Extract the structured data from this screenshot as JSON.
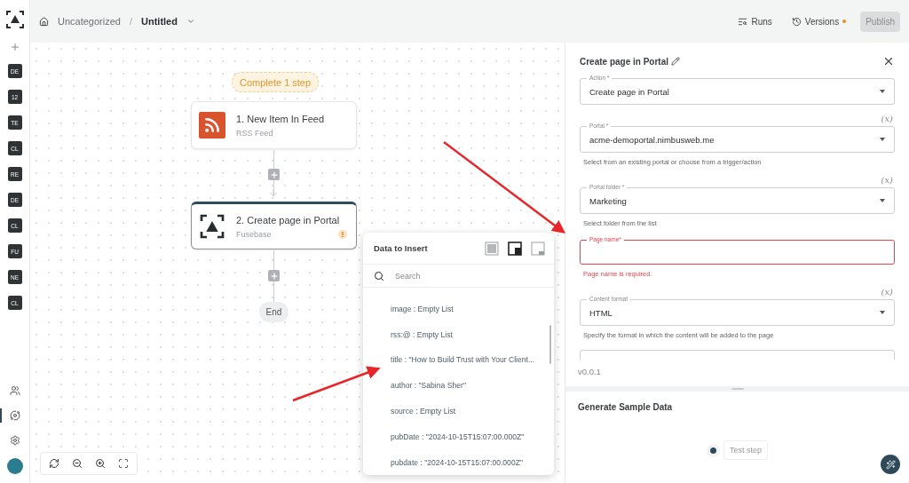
{
  "topbar": {
    "breadcrumb": [
      {
        "label": "Uncategorized",
        "current": false
      },
      {
        "label": "Untitled",
        "current": true
      }
    ],
    "separator": "/",
    "runs": "Runs",
    "versions": {
      "label": "Versions",
      "unsaved": true
    },
    "publish": {
      "label": "Publish",
      "disabled": true
    }
  },
  "sidebar": {
    "badges": [
      "DE",
      "12",
      "TE",
      "CL",
      "RE",
      "DE",
      "CL",
      "FU",
      "NE",
      "CL"
    ],
    "nav": [
      {
        "kind": "people",
        "selected": false
      },
      {
        "kind": "flows",
        "selected": true
      },
      {
        "kind": "settings",
        "selected": false
      }
    ]
  },
  "canvas": {
    "banner": "Complete 1 step",
    "steps": [
      {
        "kind": "rss",
        "title": "1. New Item In Feed",
        "subtitle": "RSS Feed",
        "warning": false,
        "selected": false
      },
      {
        "kind": "app",
        "title": "2. Create page in Portal",
        "subtitle": "Fusebase",
        "warning": true,
        "selected": true
      }
    ],
    "end_label": "End"
  },
  "popover": {
    "title": "Data to Insert",
    "layouts": [
      {
        "kind": "full",
        "selected": false
      },
      {
        "kind": "corner",
        "selected": true
      },
      {
        "kind": "bottom",
        "selected": false
      }
    ],
    "search_placeholder": "Search",
    "items": [
      "image : Empty List",
      "rss:@ : Empty List",
      "title : \"How to Build Trust with Your Client...",
      "author : \"Sabina Sher\"",
      "source : Empty List",
      "pubDate : \"2024-10-15T15:07:00.000Z\"",
      "pubdate : \"2024-10-15T15:07:00.000Z\""
    ]
  },
  "panel": {
    "title": "Create page in Portal",
    "fields": [
      {
        "kind": "select",
        "label": "Action *",
        "value": "Create page in Portal",
        "error": false
      },
      {
        "kind": "select",
        "variable": "(x)",
        "label": "Portal *",
        "value": "acme-demoportal.nimbusweb.me",
        "helper": "Select from an existing portal or choose from a trigger/action",
        "error": false
      },
      {
        "kind": "select",
        "variable": "(x)",
        "label": "Portal folder *",
        "value": "Marketing",
        "helper": "Select folder from the list",
        "error": false
      },
      {
        "kind": "input",
        "label": "Page name*",
        "helper": "Page name is required.",
        "error": true
      },
      {
        "kind": "select",
        "variable": "(x)",
        "label": "Content format",
        "value": "HTML",
        "helper": "Specify the format in which the content will be added to the page",
        "error": false
      },
      {
        "kind": "input",
        "error": false
      }
    ],
    "version": "v0.0.1"
  },
  "sample": {
    "title": "Generate Sample Data",
    "button": "Test step"
  }
}
